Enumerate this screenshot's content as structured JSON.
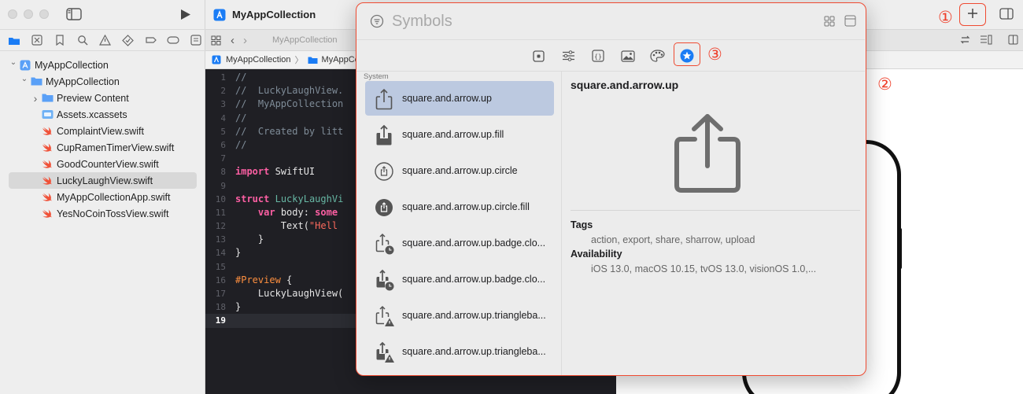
{
  "window": {
    "project_title": "MyAppCollection"
  },
  "navigator": {
    "items": [
      {
        "label": "MyAppCollection",
        "kind": "project",
        "level": 0,
        "chevron": "expanded"
      },
      {
        "label": "MyAppCollection",
        "kind": "folder",
        "level": 1,
        "chevron": "expanded"
      },
      {
        "label": "Preview Content",
        "kind": "folder",
        "level": 2,
        "chevron": "collapsed"
      },
      {
        "label": "Assets.xcassets",
        "kind": "assets",
        "level": 2
      },
      {
        "label": "ComplaintView.swift",
        "kind": "swift",
        "level": 2
      },
      {
        "label": "CupRamenTimerView.swift",
        "kind": "swift",
        "level": 2
      },
      {
        "label": "GoodCounterView.swift",
        "kind": "swift",
        "level": 2
      },
      {
        "label": "LuckyLaughView.swift",
        "kind": "swift",
        "level": 2,
        "selected": true
      },
      {
        "label": "MyAppCollectionApp.swift",
        "kind": "swift",
        "level": 2
      },
      {
        "label": "YesNoCoinTossView.swift",
        "kind": "swift",
        "level": 2
      }
    ]
  },
  "editor": {
    "tab_label": "MyAppCollection",
    "breadcrumb": [
      "MyAppCollection",
      "MyAppCollection"
    ],
    "current_line": 19,
    "lines": [
      {
        "n": "1",
        "parts": [
          [
            "c-com",
            "//"
          ]
        ]
      },
      {
        "n": "2",
        "parts": [
          [
            "c-com",
            "//  LuckyLaughView."
          ]
        ]
      },
      {
        "n": "3",
        "parts": [
          [
            "c-com",
            "//  MyAppCollection"
          ]
        ]
      },
      {
        "n": "4",
        "parts": [
          [
            "c-com",
            "//"
          ]
        ]
      },
      {
        "n": "5",
        "parts": [
          [
            "c-com",
            "//  Created by litt"
          ]
        ]
      },
      {
        "n": "6",
        "parts": [
          [
            "c-com",
            "//"
          ]
        ]
      },
      {
        "n": "7",
        "parts": []
      },
      {
        "n": "8",
        "parts": [
          [
            "c-kw",
            "import"
          ],
          [
            "c-pl",
            " SwiftUI"
          ]
        ]
      },
      {
        "n": "9",
        "parts": []
      },
      {
        "n": "10",
        "parts": [
          [
            "c-kw",
            "struct"
          ],
          [
            "c-pl",
            " "
          ],
          [
            "c-fn",
            "LuckyLaughVi"
          ]
        ]
      },
      {
        "n": "11",
        "parts": [
          [
            "c-pl",
            "    "
          ],
          [
            "c-kw",
            "var"
          ],
          [
            "c-pl",
            " body: "
          ],
          [
            "c-kw",
            "some"
          ]
        ]
      },
      {
        "n": "12",
        "parts": [
          [
            "c-pl",
            "        Text("
          ],
          [
            "c-str",
            "\"Hell"
          ]
        ]
      },
      {
        "n": "13",
        "parts": [
          [
            "c-pl",
            "    }"
          ]
        ]
      },
      {
        "n": "14",
        "parts": [
          [
            "c-pl",
            "}"
          ]
        ]
      },
      {
        "n": "15",
        "parts": []
      },
      {
        "n": "16",
        "parts": [
          [
            "c-mac",
            "#Preview"
          ],
          [
            "c-pl",
            " {"
          ]
        ]
      },
      {
        "n": "17",
        "parts": [
          [
            "c-pl",
            "    LuckyLaughView("
          ]
        ]
      },
      {
        "n": "18",
        "parts": [
          [
            "c-pl",
            "}"
          ]
        ]
      },
      {
        "n": "19",
        "parts": []
      }
    ]
  },
  "library": {
    "search_placeholder": "Symbols",
    "section_label": "System",
    "categories": [
      "views-icon",
      "modifiers-icon",
      "snippets-icon",
      "media-icon",
      "colors-icon",
      "symbols-icon"
    ],
    "active_category": "symbols-icon",
    "symbols": [
      {
        "name": "square.and.arrow.up",
        "icon": "share-outline",
        "selected": true
      },
      {
        "name": "square.and.arrow.up.fill",
        "icon": "share-fill"
      },
      {
        "name": "square.and.arrow.up.circle",
        "icon": "share-circle"
      },
      {
        "name": "square.and.arrow.up.circle.fill",
        "icon": "share-circle-fill"
      },
      {
        "name": "square.and.arrow.up.badge.clo...",
        "icon": "share-clock"
      },
      {
        "name": "square.and.arrow.up.badge.clo...",
        "icon": "share-clock-fill"
      },
      {
        "name": "square.and.arrow.up.triangleba...",
        "icon": "share-warning"
      },
      {
        "name": "square.and.arrow.up.triangleba...",
        "icon": "share-warning-fill"
      }
    ],
    "detail": {
      "name": "square.and.arrow.up",
      "tags_label": "Tags",
      "tags": "action, export, share, sharrow, upload",
      "availability_label": "Availability",
      "availability": "iOS 13.0, macOS 10.15, tvOS 13.0, visionOS 1.0,..."
    }
  },
  "annotations": {
    "one": "①",
    "two": "②",
    "three": "③",
    "color": "#ef3f2a"
  },
  "colors": {
    "accent": "#1a7cf5",
    "highlight": "#ef4b32"
  }
}
